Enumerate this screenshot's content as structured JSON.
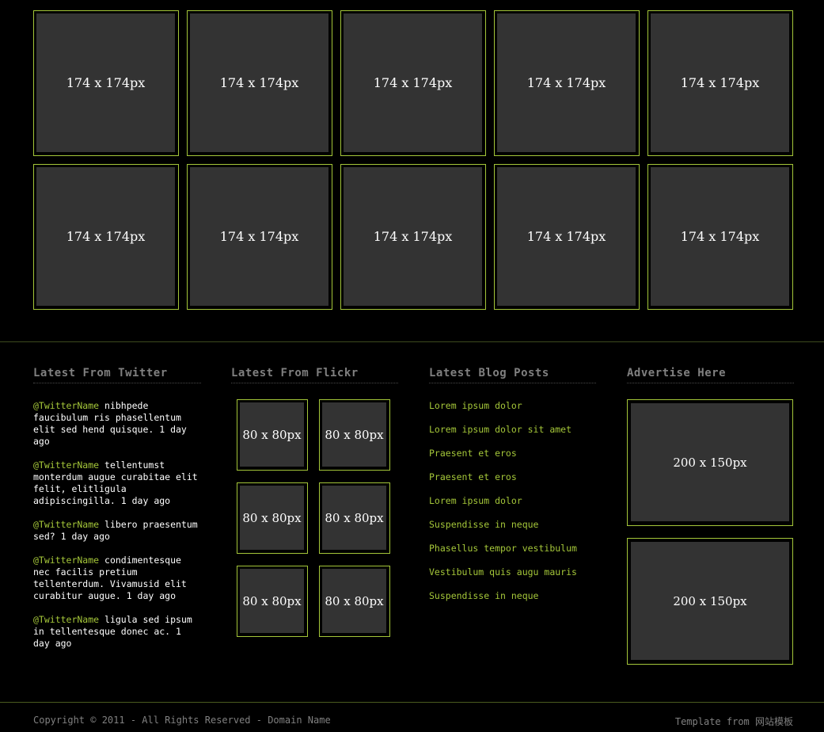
{
  "gallery": {
    "items": [
      "174 x 174px",
      "174 x 174px",
      "174 x 174px",
      "174 x 174px",
      "174 x 174px",
      "174 x 174px",
      "174 x 174px",
      "174 x 174px",
      "174 x 174px",
      "174 x 174px"
    ]
  },
  "twitter": {
    "title": "Latest From Twitter",
    "tweets": [
      {
        "handle": "@TwitterName",
        "text": " nibhpede faucibulum ris phasellentum elit sed hend quisque. 1 day ago"
      },
      {
        "handle": "@TwitterName",
        "text": " tellentumst monterdum augue curabitae elit felit, elitligula adipiscingilla. 1 day ago"
      },
      {
        "handle": "@TwitterName",
        "text": " libero praesentum sed? 1 day ago"
      },
      {
        "handle": "@TwitterName",
        "text": " condimentesque nec facilis pretium tellenterdum. Vivamusid elit curabitur augue. 1 day ago"
      },
      {
        "handle": "@TwitterName",
        "text": " ligula sed ipsum in tellentesque donec ac. 1 day ago"
      }
    ]
  },
  "flickr": {
    "title": "Latest From Flickr",
    "items": [
      "80 x 80px",
      "80 x 80px",
      "80 x 80px",
      "80 x 80px",
      "80 x 80px",
      "80 x 80px"
    ]
  },
  "blog": {
    "title": "Latest Blog Posts",
    "posts": [
      "Lorem ipsum dolor",
      "Lorem ipsum dolor sit amet",
      "Praesent et eros",
      "Praesent et eros",
      "Lorem ipsum dolor",
      "Suspendisse in neque",
      "Phasellus tempor vestibulum",
      "Vestibulum quis augu mauris",
      "Suspendisse in neque"
    ]
  },
  "ads": {
    "title": "Advertise Here",
    "items": [
      "200 x 150px",
      "200 x 150px"
    ]
  },
  "footer": {
    "copyright": "Copyright © 2011 - All Rights Reserved - Domain Name",
    "credit": "Template from 网站模板"
  },
  "colors": {
    "background": "#000000",
    "accent": "#a4c639",
    "placeholder": "#333333",
    "muted_text": "#808080"
  }
}
